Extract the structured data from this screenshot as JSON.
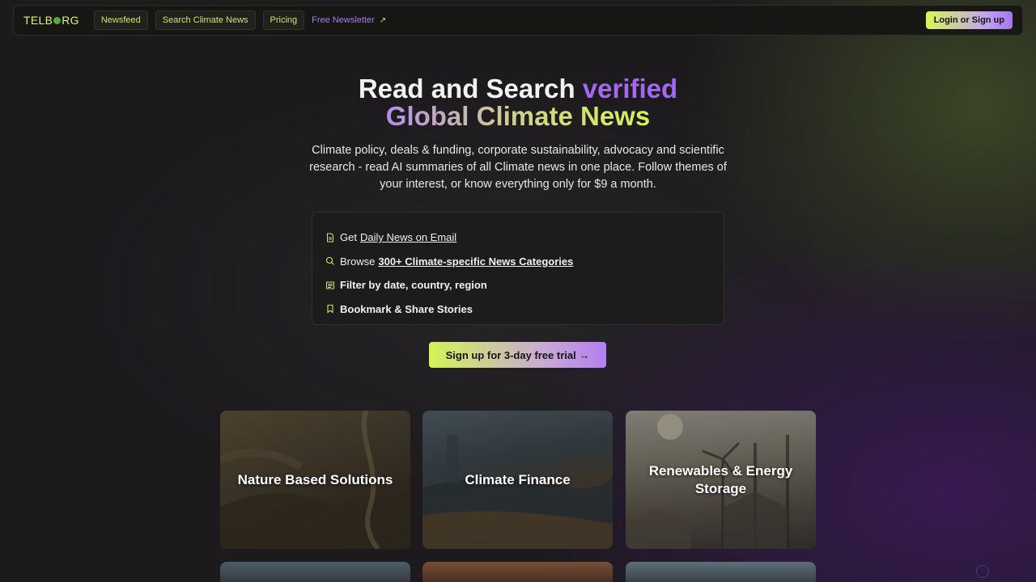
{
  "nav": {
    "logo_pre": "TELB",
    "logo_post": "RG",
    "items": [
      {
        "label": "Newsfeed"
      },
      {
        "label": "Search Climate News"
      },
      {
        "label": "Pricing"
      }
    ],
    "newsletter": "Free Newsletter",
    "newsletter_icon": "↗",
    "login": "Login or Sign up"
  },
  "hero": {
    "title_line1_a": "Read and Search ",
    "title_line1_b": "verified",
    "title_line2": "Global Climate News",
    "subtitle": "Climate policy, deals & funding, corporate sustainability, advocacy and scientific research - read AI summaries of all Climate news in one place. Follow themes of your interest, or know everything only for $9 a month."
  },
  "features": [
    {
      "prefix": "Get",
      "link": "Daily News on Email",
      "icon": "document-icon"
    },
    {
      "prefix": "Browse",
      "link": "300+ Climate-specific News Categories",
      "icon": "search-icon"
    },
    {
      "text": "Filter by date, country, region",
      "icon": "filter-icon"
    },
    {
      "text": "Bookmark & Share Stories",
      "icon": "bookmark-icon"
    }
  ],
  "cta": "Sign up for 3-day free trial →",
  "cards": [
    {
      "label": "Nature Based Solutions"
    },
    {
      "label": "Climate Finance"
    },
    {
      "label": "Renewables & Energy Storage"
    }
  ],
  "colors": {
    "accent_green": "#d6f56b",
    "accent_purple": "#a368ee"
  }
}
